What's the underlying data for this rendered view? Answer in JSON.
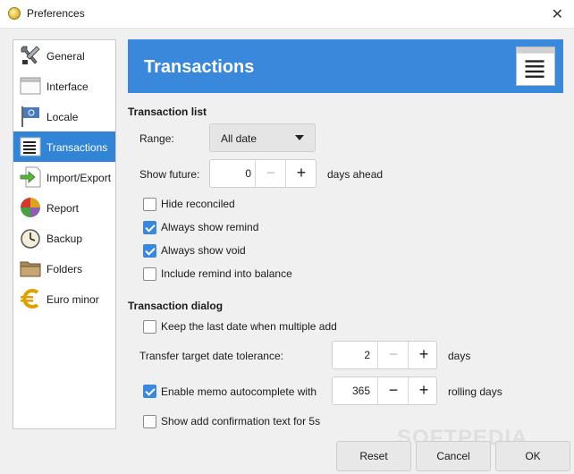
{
  "window": {
    "title": "Preferences"
  },
  "sidebar": {
    "items": [
      {
        "label": "General",
        "icon": "tools-icon"
      },
      {
        "label": "Interface",
        "icon": "window-icon"
      },
      {
        "label": "Locale",
        "icon": "flag-icon"
      },
      {
        "label": "Transactions",
        "icon": "list-icon",
        "active": true
      },
      {
        "label": "Import/Export",
        "icon": "import-export-icon"
      },
      {
        "label": "Report",
        "icon": "pie-chart-icon"
      },
      {
        "label": "Backup",
        "icon": "clock-icon"
      },
      {
        "label": "Folders",
        "icon": "folder-icon"
      },
      {
        "label": "Euro minor",
        "icon": "euro-icon"
      }
    ]
  },
  "header": {
    "title": "Transactions"
  },
  "transaction_list": {
    "section_title": "Transaction list",
    "range_label": "Range:",
    "range_value": "All date",
    "show_future_label": "Show future:",
    "show_future_value": "0",
    "show_future_unit": "days ahead",
    "checkboxes": [
      {
        "label": "Hide reconciled",
        "checked": false
      },
      {
        "label": "Always show remind",
        "checked": true
      },
      {
        "label": "Always show void",
        "checked": true
      },
      {
        "label": "Include remind into balance",
        "checked": false
      }
    ]
  },
  "transaction_dialog": {
    "section_title": "Transaction dialog",
    "keep_last_date_label": "Keep the last date when multiple add",
    "keep_last_date_checked": false,
    "tolerance_label": "Transfer target date tolerance:",
    "tolerance_value": "2",
    "tolerance_unit": "days",
    "memo_label": "Enable memo autocomplete with",
    "memo_checked": true,
    "memo_value": "365",
    "memo_unit": "rolling days",
    "confirm_label": "Show add confirmation text for 5s",
    "confirm_checked": false
  },
  "buttons": {
    "reset": "Reset",
    "cancel": "Cancel",
    "ok": "OK"
  },
  "spin_symbols": {
    "minus": "−",
    "plus": "+"
  },
  "watermark": "SOFTPEDIA",
  "colors": {
    "accent": "#3a88dc",
    "selected": "#3184d6"
  }
}
